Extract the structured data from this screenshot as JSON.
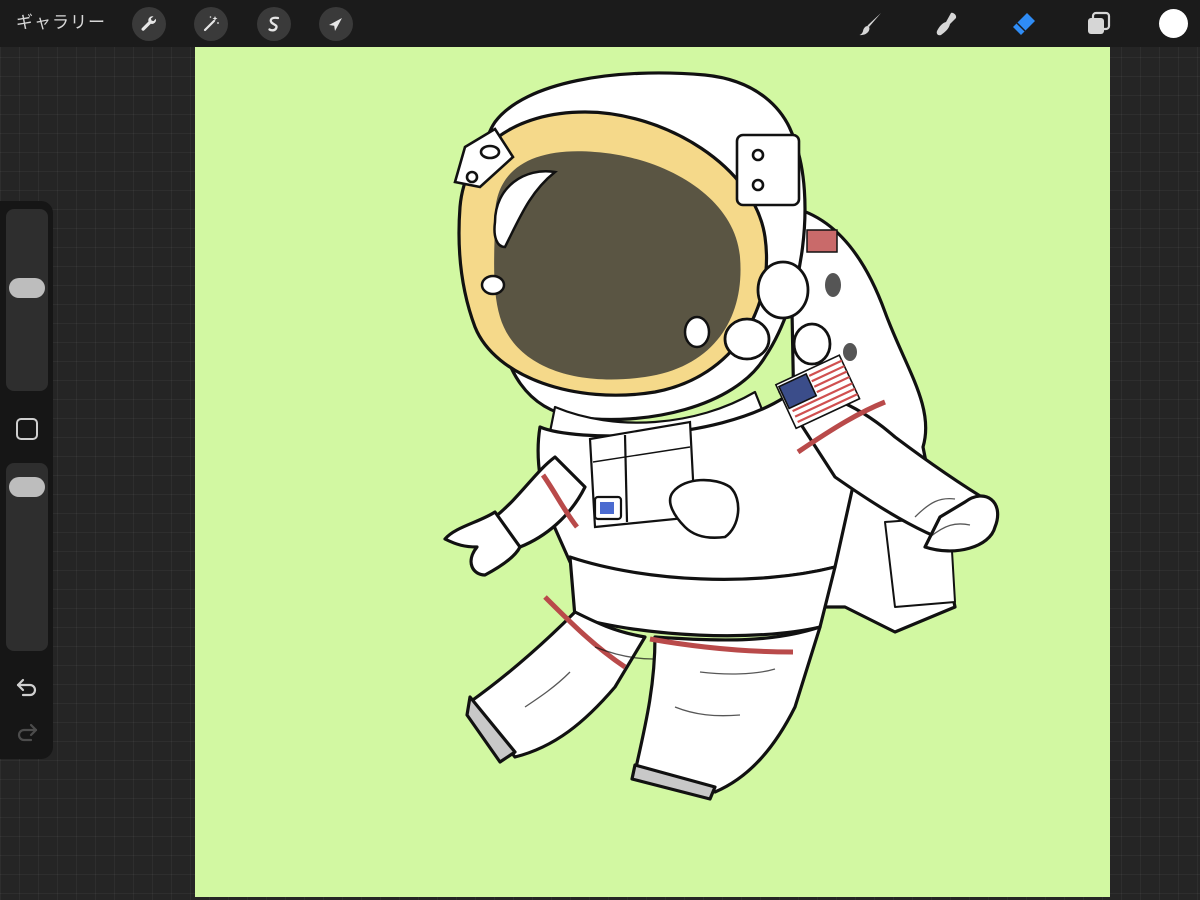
{
  "topbar": {
    "gallery_label": "ギャラリー",
    "left_tools": [
      {
        "name": "actions",
        "icon": "wrench-icon"
      },
      {
        "name": "adjustments",
        "icon": "magic-wand-icon"
      },
      {
        "name": "selection",
        "icon": "selection-s-icon"
      },
      {
        "name": "transform",
        "icon": "arrow-cursor-icon"
      }
    ],
    "right_tools": [
      {
        "name": "brush",
        "icon": "brush-icon",
        "active": false
      },
      {
        "name": "smudge",
        "icon": "smudge-icon",
        "active": false
      },
      {
        "name": "eraser",
        "icon": "eraser-icon",
        "active": true
      },
      {
        "name": "layers",
        "icon": "layers-icon",
        "active": false
      }
    ],
    "current_color": "#ffffff"
  },
  "sidebar": {
    "brush_size_level": 0.58,
    "brush_opacity_level": 0.93,
    "undo_icon": "undo-arrow-icon",
    "redo_icon": "redo-arrow-icon",
    "redo_enabled": false
  },
  "canvas": {
    "background_color": "#d2f8a2",
    "artwork": "astronaut-illustration"
  },
  "colors": {
    "accent": "#2f8cf5",
    "toolbar": "#1b1b1b",
    "visor_gold": "#f5d98a",
    "visor_dark": "#5a5543",
    "suit_red": "#b94a4a",
    "flag_blue": "#3b4d8a"
  }
}
